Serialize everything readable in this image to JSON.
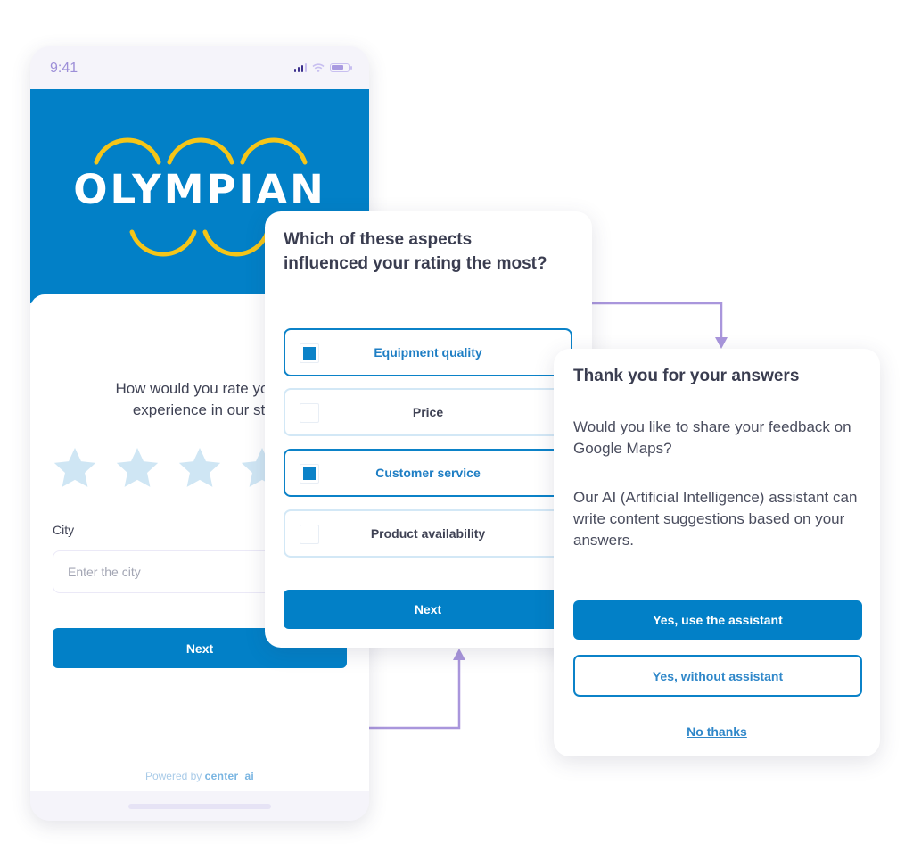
{
  "phone": {
    "status_bar": {
      "time": "9:41",
      "icons": [
        "signal-icon",
        "wifi-icon",
        "battery-icon"
      ]
    },
    "brand": {
      "name": "OLYMPIAN",
      "colors": {
        "band": "#0280c7",
        "rings": "#f5c518",
        "text": "#ffffff"
      }
    },
    "rating": {
      "question": "How would you rate your experience in our store?",
      "visible_question_lines": [
        "How would you rate your",
        "experience in our st"
      ],
      "stars_total": 5,
      "stars_selected": 0
    },
    "city": {
      "label": "City",
      "placeholder": "Enter the city",
      "value": ""
    },
    "next_label": "Next",
    "powered_by": {
      "prefix": "Powered by",
      "brand": "center_ai"
    }
  },
  "aspects_card": {
    "question": "Which of these aspects influenced your rating the most?",
    "options": [
      {
        "label": "Equipment quality",
        "checked": true
      },
      {
        "label": "Price",
        "checked": false
      },
      {
        "label": "Customer service",
        "checked": true
      },
      {
        "label": "Product availability",
        "checked": false
      }
    ],
    "next_label": "Next"
  },
  "thanks_card": {
    "title": "Thank you for your answers",
    "paragraph_1": "Would you like to share your feedback on Google Maps?",
    "paragraph_2": "Our AI (Artificial Intelligence) assistant can write content suggestions based on your answers.",
    "primary_button": "Yes, use the assistant",
    "secondary_button": "Yes, without assistant",
    "link": "No thanks"
  },
  "theme": {
    "primary": "#0280c7",
    "connector": "#a996dc",
    "star_empty": "#cfe6f4"
  }
}
